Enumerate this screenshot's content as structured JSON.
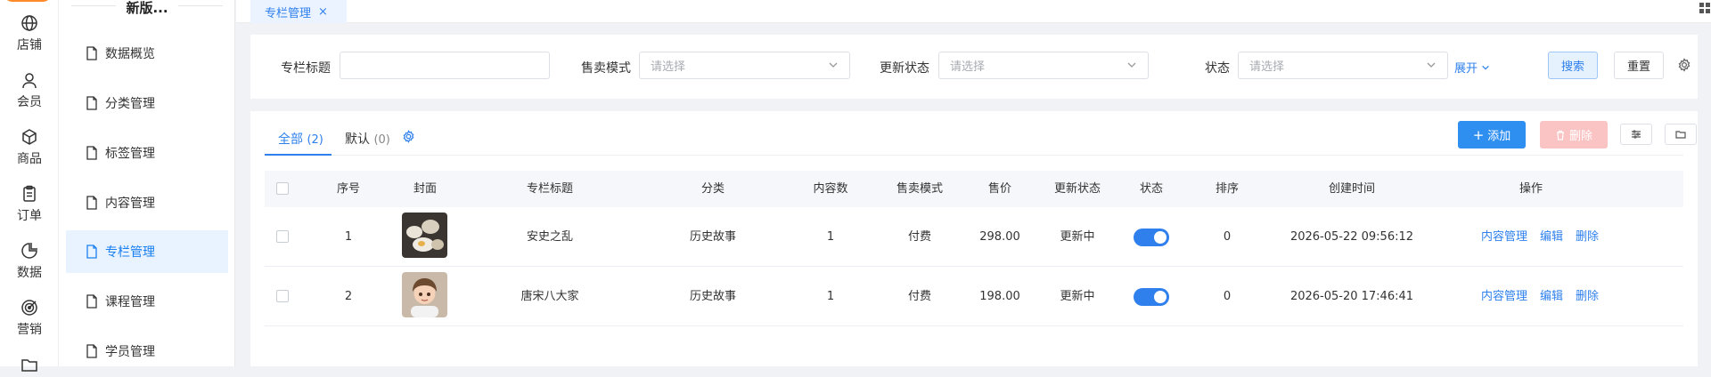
{
  "rail": {
    "items": [
      {
        "label": "店铺",
        "icon": "globe-icon"
      },
      {
        "label": "会员",
        "icon": "user-icon"
      },
      {
        "label": "商品",
        "icon": "box-icon"
      },
      {
        "label": "订单",
        "icon": "clipboard-icon"
      },
      {
        "label": "数据",
        "icon": "pie-chart-icon"
      },
      {
        "label": "营销",
        "icon": "target-icon"
      }
    ]
  },
  "sidebar": {
    "title": "新版...",
    "items": [
      {
        "label": "数据概览"
      },
      {
        "label": "分类管理"
      },
      {
        "label": "标签管理"
      },
      {
        "label": "内容管理"
      },
      {
        "label": "专栏管理",
        "active": true
      },
      {
        "label": "课程管理"
      },
      {
        "label": "学员管理"
      }
    ]
  },
  "tabbar": {
    "active_tab": "专栏管理",
    "close_glyph": "×"
  },
  "filters": {
    "title_label": "专栏标题",
    "title_value": "",
    "sale_mode_label": "售卖模式",
    "sale_mode_placeholder": "请选择",
    "update_status_label": "更新状态",
    "update_status_placeholder": "请选择",
    "status_label": "状态",
    "status_placeholder": "请选择",
    "expand_label": "展开",
    "search_label": "搜索",
    "reset_label": "重置"
  },
  "list_tabs": [
    {
      "label": "全部",
      "count": "(2)",
      "active": true
    },
    {
      "label": "默认",
      "count": "(0)",
      "active": false
    }
  ],
  "actions": {
    "add_label": "添加",
    "delete_label": "删除",
    "add_glyph": "+"
  },
  "table": {
    "columns": [
      "序号",
      "封面",
      "专栏标题",
      "分类",
      "内容数",
      "售卖模式",
      "售价",
      "更新状态",
      "状态",
      "排序",
      "创建时间",
      "操作"
    ],
    "rows": [
      {
        "index": "1",
        "title": "安史之乱",
        "category": "历史故事",
        "content_count": "1",
        "sale_mode": "付费",
        "price": "298.00",
        "update_status": "更新中",
        "enabled": true,
        "sort": "0",
        "created": "2026-05-22 09:56:12",
        "ops": [
          "内容管理",
          "编辑",
          "删除"
        ]
      },
      {
        "index": "2",
        "title": "唐宋八大家",
        "category": "历史故事",
        "content_count": "1",
        "sale_mode": "付费",
        "price": "198.00",
        "update_status": "更新中",
        "enabled": true,
        "sort": "0",
        "created": "2026-05-20 17:46:41",
        "ops": [
          "内容管理",
          "编辑",
          "删除"
        ]
      }
    ]
  },
  "colors": {
    "primary": "#2f80ed",
    "danger_disabled": "#fbc4c4",
    "accent_orange": "#ff8a2a"
  }
}
